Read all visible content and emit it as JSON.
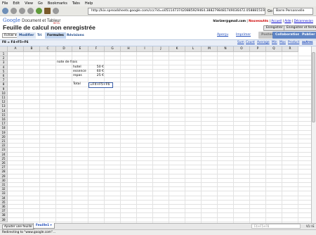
{
  "menubar": {
    "items": [
      "File",
      "Edit",
      "View",
      "Go",
      "Bookmarks",
      "Tabs",
      "Help"
    ]
  },
  "browser": {
    "url": "http://kix.spreadsheets.google.com/ccc?id=o05114737420885929464.3882798481749036472.05888151912...",
    "go_label": "Go",
    "search_text": "Barre Personnelle"
  },
  "header": {
    "logo_prefix": "Google",
    "logo_product": "Document et Tableur",
    "beta": "BETA",
    "doc_title": "Feuille de calcul non enregistrée",
    "user_email": "hlarizer@gmail.com",
    "links": [
      "Nouveautés",
      "Accueil",
      "Aide",
      "Déconnexion"
    ],
    "save_button": "Enregistrer",
    "save_close_button": "Enregistrer et fermer"
  },
  "tabs": {
    "fichier": "Fichier",
    "items": [
      "Modifier",
      "Tri",
      "Formules",
      "Révisions"
    ],
    "apercu": "Aperçu",
    "imprimer": "Imprimer",
    "right_items": [
      "Poster",
      "Collaboration",
      "Publier"
    ]
  },
  "formula_toolbar": {
    "cell_ref": "F8 = F4+F5+F6",
    "functions": [
      "Sum",
      "Count",
      "Average",
      "Min",
      "Max",
      "Product",
      "autres"
    ]
  },
  "grid": {
    "columns": [
      "A",
      "B",
      "C",
      "D",
      "E",
      "F",
      "G",
      "H",
      "I",
      "J",
      "K",
      "L",
      "M",
      "N",
      "O",
      "P",
      "Q",
      "R"
    ],
    "rows": [
      "1",
      "2",
      "3",
      "4",
      "5",
      "6",
      "7",
      "8",
      "9",
      "10",
      "11",
      "12",
      "13",
      "14",
      "15",
      "16",
      "17",
      "18",
      "19",
      "20",
      "21",
      "22",
      "23",
      "24",
      "25",
      "26",
      "27",
      "28",
      "29",
      "30",
      "31",
      "32",
      "33",
      "34",
      "35",
      "36",
      "37",
      "38",
      "39"
    ],
    "cells": {
      "D3": "note de frais",
      "E4": "hotel",
      "F4": "50 €",
      "E5": "essence",
      "F5": "60 €",
      "E6": "repas",
      "F6": "25 €",
      "E8": "Total",
      "F8": "=F4+F5+F6"
    }
  },
  "sheets": {
    "add_label": "Ajouter une feuille",
    "tabs": [
      "Feuille1"
    ],
    "summary": "F4+F5+F6",
    "zoom": "V1 I E"
  },
  "status": {
    "text": "Redirecting to \"www.google.com\"..."
  }
}
